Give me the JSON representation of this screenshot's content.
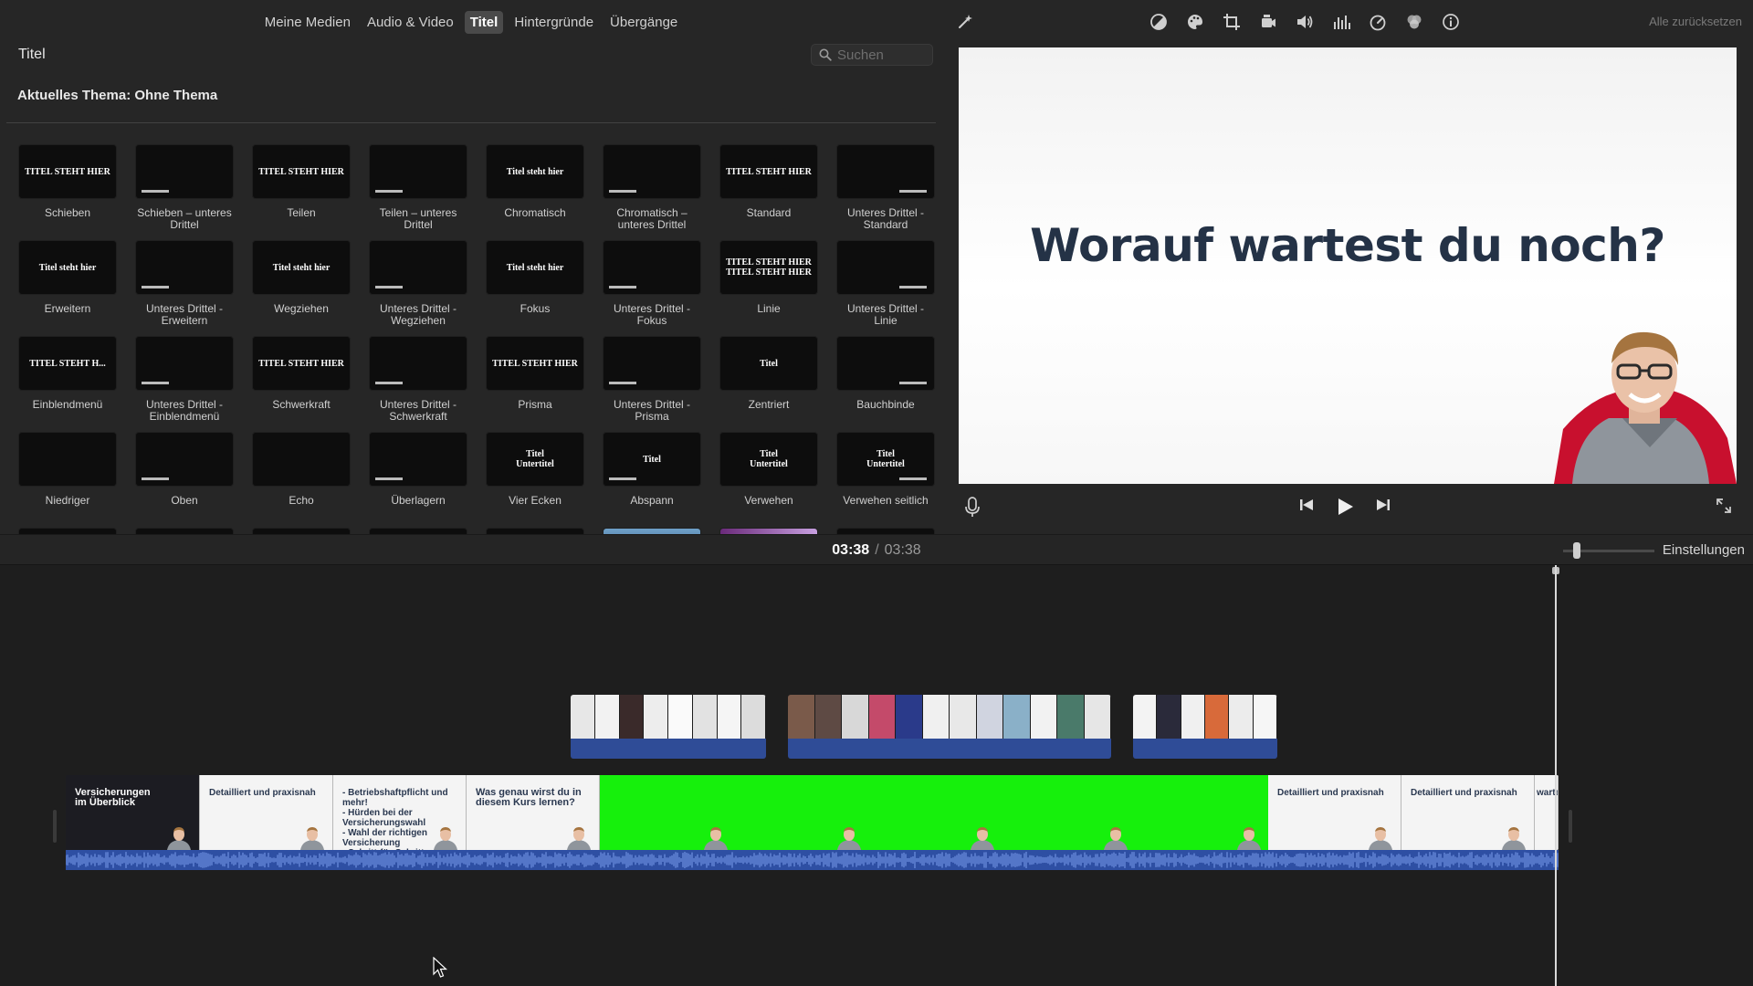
{
  "browser": {
    "tabs": [
      {
        "label": "Meine Medien",
        "active": false
      },
      {
        "label": "Audio & Video",
        "active": false
      },
      {
        "label": "Titel",
        "active": true
      },
      {
        "label": "Hintergründe",
        "active": false
      },
      {
        "label": "Übergänge",
        "active": false
      }
    ],
    "section_title": "Titel",
    "search_placeholder": "Suchen",
    "theme_label": "Aktuelles Thema: Ohne Thema",
    "titles": [
      {
        "caption": "Schieben",
        "thumb": "TITEL STEHT HIER"
      },
      {
        "caption": "Schieben – unteres\nDrittel",
        "thumb": ""
      },
      {
        "caption": "Teilen",
        "thumb": "TITEL STEHT HIER"
      },
      {
        "caption": "Teilen – unteres\nDrittel",
        "thumb": ""
      },
      {
        "caption": "Chromatisch",
        "thumb": "Titel steht hier"
      },
      {
        "caption": "Chromatisch –\nunteres Drittel",
        "thumb": ""
      },
      {
        "caption": "Standard",
        "thumb": "TITEL STEHT HIER"
      },
      {
        "caption": "Unteres Drittel -\nStandard",
        "thumb": ""
      },
      {
        "caption": "Erweitern",
        "thumb": "Titel steht hier"
      },
      {
        "caption": "Unteres Drittel -\nErweitern",
        "thumb": ""
      },
      {
        "caption": "Wegziehen",
        "thumb": "Titel steht hier"
      },
      {
        "caption": "Unteres Drittel -\nWegziehen",
        "thumb": ""
      },
      {
        "caption": "Fokus",
        "thumb": "Titel steht hier"
      },
      {
        "caption": "Unteres Drittel -\nFokus",
        "thumb": ""
      },
      {
        "caption": "Linie",
        "thumb": "TITEL STEHT HIER\nTITEL STEHT HIER"
      },
      {
        "caption": "Unteres Drittel -\nLinie",
        "thumb": ""
      },
      {
        "caption": "Einblendmenü",
        "thumb": "TITEL STEHT H..."
      },
      {
        "caption": "Unteres Drittel -\nEinblendmenü",
        "thumb": ""
      },
      {
        "caption": "Schwerkraft",
        "thumb": "TITEL STEHT HIER"
      },
      {
        "caption": "Unteres Drittel -\nSchwerkraft",
        "thumb": ""
      },
      {
        "caption": "Prisma",
        "thumb": "TITEL STEHT HIER"
      },
      {
        "caption": "Unteres Drittel -\nPrisma",
        "thumb": ""
      },
      {
        "caption": "Zentriert",
        "thumb": "Titel"
      },
      {
        "caption": "Bauchbinde",
        "thumb": ""
      },
      {
        "caption": "Niedriger",
        "thumb": ""
      },
      {
        "caption": "Oben",
        "thumb": ""
      },
      {
        "caption": "Echo",
        "thumb": ""
      },
      {
        "caption": "Überlagern",
        "thumb": ""
      },
      {
        "caption": "Vier Ecken",
        "thumb": "Titel\nUntertitel"
      },
      {
        "caption": "Abspann",
        "thumb": "Titel"
      },
      {
        "caption": "Verwehen",
        "thumb": "Titel\nUntertitel"
      },
      {
        "caption": "Verwehen seitlich",
        "thumb": "Titel\nUntertitel"
      }
    ]
  },
  "viewer": {
    "reset_label": "Alle zurücksetzen",
    "headline": "Worauf wartest du noch?",
    "tool_icons": [
      "magic-wand-icon",
      "color-balance-icon",
      "color-palette-icon",
      "crop-icon",
      "camera-icon",
      "volume-icon",
      "equalizer-icon",
      "speed-icon",
      "filter-icon",
      "info-icon"
    ]
  },
  "timeline": {
    "current_time": "03:38",
    "separator": "/",
    "total_time": "03:38",
    "settings_label": "Einstellungen",
    "segments": [
      {
        "type": "dark",
        "text": "Versicherungen\nim Überblick"
      },
      {
        "type": "light",
        "text": "Detailliert und praxisnah"
      },
      {
        "type": "light",
        "text": "- Betriebshaftpflicht und mehr!\n- Hürden bei der Versicherungswahl\n- Wahl der richtigen Versicherung\n- Schritt-für-Schritt-Anleitungen"
      },
      {
        "type": "light",
        "text": "Was genau wirst du in\ndiesem Kurs lernen?"
      },
      {
        "type": "green",
        "text": ""
      },
      {
        "type": "light",
        "text": "Detailliert und praxisnah"
      },
      {
        "type": "light",
        "text": "Detailliert und praxisnah"
      },
      {
        "type": "light",
        "text": "wartest"
      }
    ]
  },
  "colors": {
    "accent_blue": "#2e4fa3",
    "green_screen": "#16f00c",
    "headline": "#243246"
  }
}
